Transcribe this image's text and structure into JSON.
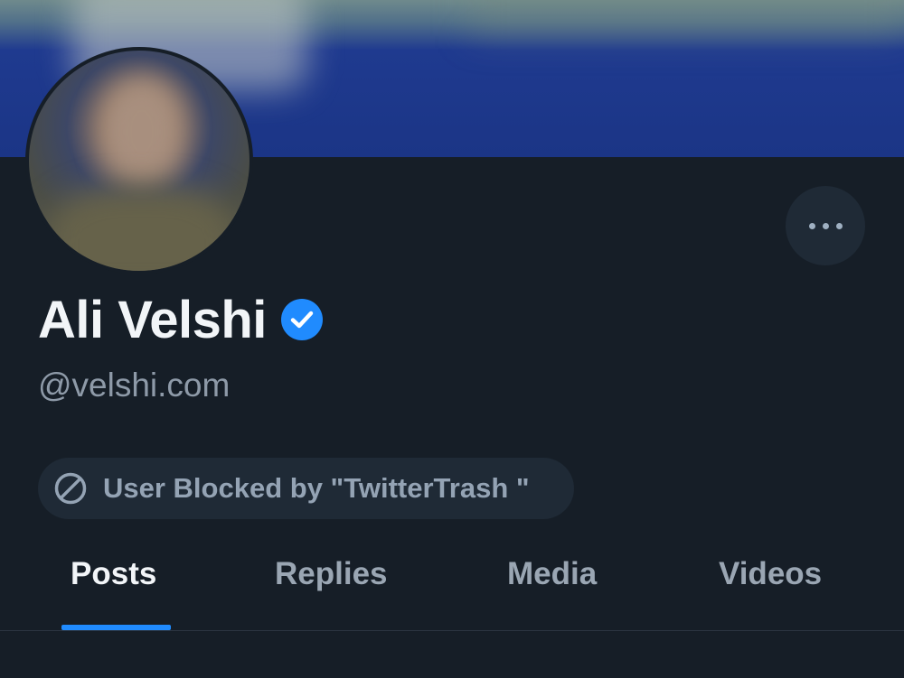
{
  "profile": {
    "display_name": "Ali Velshi",
    "handle": "@velshi.com",
    "verified_icon": "verified-check-icon",
    "more_icon": "ellipsis-icon"
  },
  "blocked_notice": {
    "icon": "blocked-circle-slash-icon",
    "text": "User Blocked by \"TwitterTrash \""
  },
  "tabs": [
    {
      "label": "Posts",
      "active": true
    },
    {
      "label": "Replies",
      "active": false
    },
    {
      "label": "Media",
      "active": false
    },
    {
      "label": "Videos",
      "active": false
    }
  ],
  "colors": {
    "background": "#161e27",
    "accent": "#208bfe",
    "banner": "#1b3586",
    "muted_text": "#8e9aa8"
  }
}
